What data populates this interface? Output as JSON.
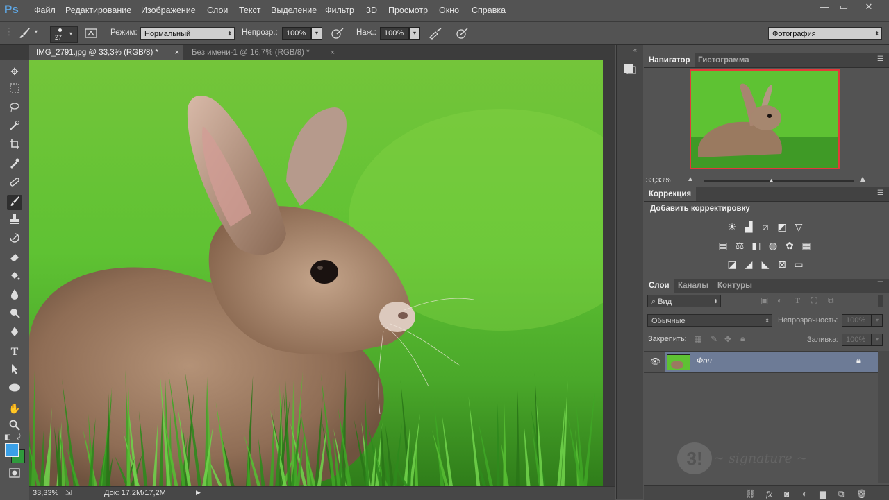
{
  "app": {
    "logo": "Ps"
  },
  "menu": [
    "Файл",
    "Редактирование",
    "Изображение",
    "Слои",
    "Текст",
    "Выделение",
    "Фильтр",
    "3D",
    "Просмотр",
    "Окно",
    "Справка"
  ],
  "window_controls": {
    "minimize": "—",
    "restore": "▭",
    "close": "✕"
  },
  "options": {
    "brush_size": "27",
    "mode_label": "Режим:",
    "mode_value": "Нормальный",
    "opacity_label": "Непрозр.:",
    "opacity_value": "100%",
    "flow_label": "Наж.:",
    "flow_value": "100%",
    "workspace": "Фотография"
  },
  "tabs": [
    {
      "label": "IMG_2791.jpg @ 33,3% (RGB/8) *",
      "close": "×"
    },
    {
      "label": "Без имени-1 @ 16,7% (RGB/8) *",
      "close": "×"
    }
  ],
  "status": {
    "zoom": "33,33%",
    "doc": "Док: 17,2M/17,2M"
  },
  "navigator": {
    "tab_active": "Навигатор",
    "tab_inactive": "Гистограмма",
    "zoom": "33,33%",
    "zoom_slider_fraction": 0.45
  },
  "adjustments": {
    "tab": "Коррекция",
    "title": "Добавить корректировку",
    "icons": [
      [
        "brightness-icon",
        "levels-icon",
        "curves-icon",
        "exposure-icon",
        "vibrance-icon"
      ],
      [
        "hue-saturation-icon",
        "color-balance-icon",
        "black-white-icon",
        "photo-filter-icon",
        "channel-mixer-icon",
        "color-lookup-icon"
      ],
      [
        "invert-icon",
        "posterize-icon",
        "threshold-icon",
        "selective-color-icon",
        "gradient-map-icon"
      ]
    ]
  },
  "layers": {
    "tab_active": "Слои",
    "tab2": "Каналы",
    "tab3": "Контуры",
    "filter": "Вид",
    "blend_mode": "Обычные",
    "opacity_label": "Непрозрачность:",
    "opacity_value": "100%",
    "lock_label": "Закрепить:",
    "fill_label": "Заливка:",
    "fill_value": "100%",
    "items": [
      {
        "name": "Фон",
        "visible": true,
        "locked": true
      }
    ]
  },
  "colors": {
    "foreground": "#3aa0e8",
    "background": "#2f9a3c",
    "layer_highlight": "#6d7b96",
    "nav_frame": "#e23a3a"
  }
}
